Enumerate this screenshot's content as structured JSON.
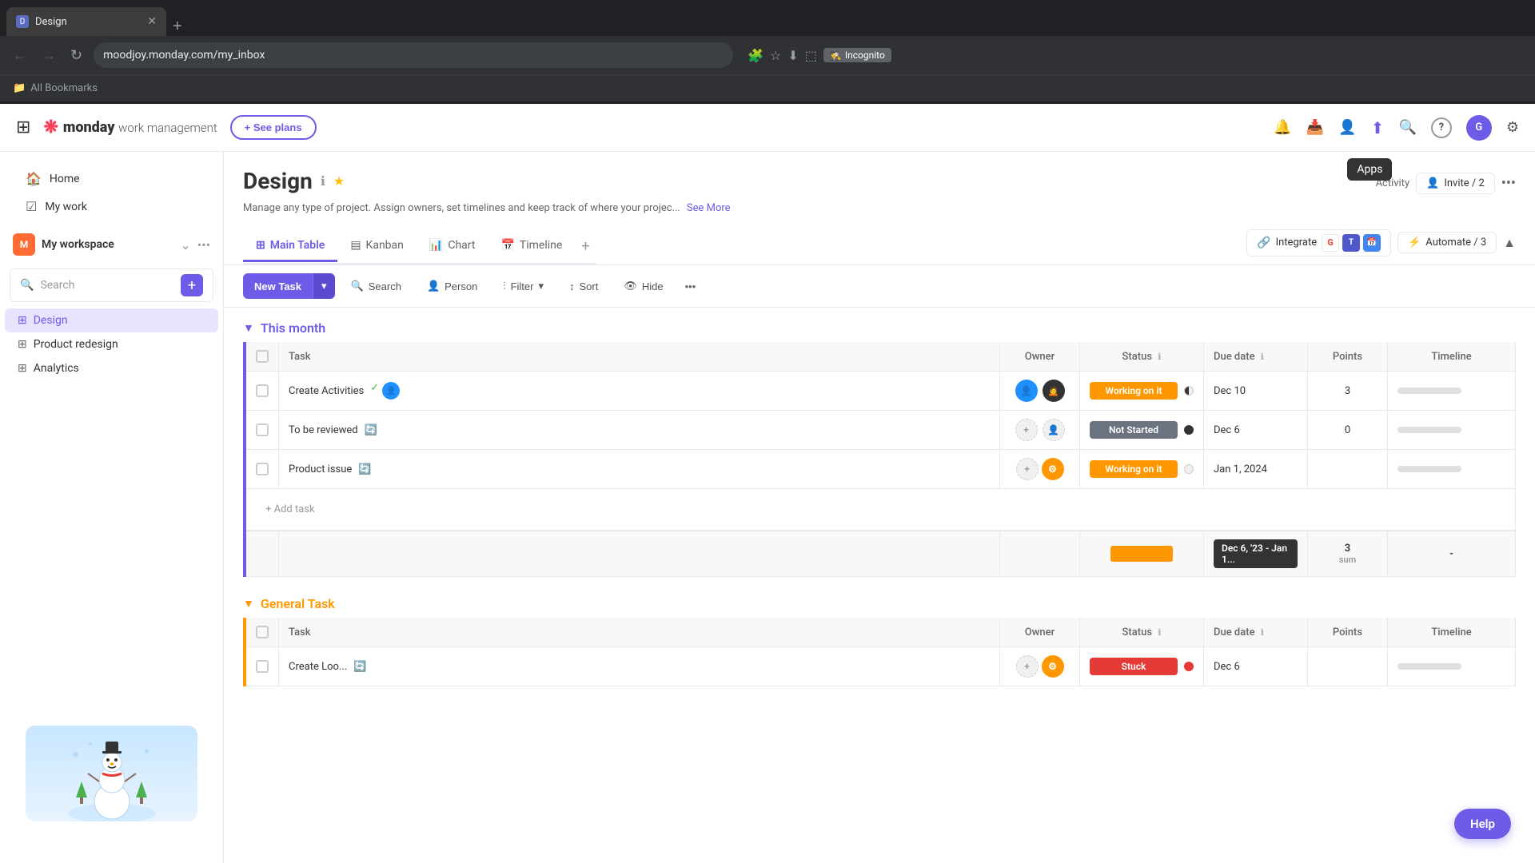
{
  "browser": {
    "tab_title": "Design",
    "tab_favicon": "D",
    "url": "moodjoy.monday.com/my_inbox",
    "tab_new_label": "+",
    "incognito_label": "Incognito",
    "bookmarks_label": "All Bookmarks"
  },
  "nav": {
    "grid_icon": "⊞",
    "logo_brand": "monday",
    "logo_suffix": "work management",
    "see_plans_label": "+ See plans",
    "bell_icon": "🔔",
    "inbox_icon": "📥",
    "person_icon": "👤",
    "update_icon": "⬆",
    "search_icon": "🔍",
    "help_icon": "?",
    "apps_tooltip": "Apps"
  },
  "sidebar": {
    "home_label": "Home",
    "mywork_label": "My work",
    "workspace_avatar": "M",
    "workspace_name": "My workspace",
    "search_placeholder": "Search",
    "add_icon": "+",
    "items": [
      {
        "label": "Design",
        "active": true
      },
      {
        "label": "Product redesign",
        "active": false
      },
      {
        "label": "Analytics",
        "active": false
      }
    ]
  },
  "page": {
    "title": "Design",
    "info_icon": "ℹ",
    "star_icon": "★",
    "description": "Manage any type of project. Assign owners, set timelines and keep track of where your projec...",
    "see_more": "See More",
    "activity_label": "Activity",
    "invite_label": "Invite / 2",
    "more_icon": "•••",
    "integrate_label": "Integrate",
    "automate_label": "Automate / 3",
    "collapse_icon": "▲"
  },
  "tabs": [
    {
      "label": "Main Table",
      "icon": "⊞",
      "active": true
    },
    {
      "label": "Kanban",
      "icon": "▤",
      "active": false
    },
    {
      "label": "Chart",
      "icon": "📊",
      "active": false
    },
    {
      "label": "Timeline",
      "icon": "📅",
      "active": false
    }
  ],
  "toolbar": {
    "new_task_label": "New Task",
    "search_label": "Search",
    "person_label": "Person",
    "filter_label": "Filter",
    "sort_label": "Sort",
    "hide_label": "Hide",
    "more_icon": "•••"
  },
  "groups": [
    {
      "title": "This month",
      "color": "#6c5ce7",
      "columns": [
        "Task",
        "Owner",
        "Status",
        "Due date",
        "Points",
        "Timeline"
      ],
      "rows": [
        {
          "task": "Create Activities",
          "owner": "avatar-blue",
          "owner2": "avatar-dark",
          "status": "Working on it",
          "status_class": "status-working",
          "due_date": "Dec 10",
          "status_dot_class": "dot-half",
          "points": "3",
          "timeline": ""
        },
        {
          "task": "To be reviewed",
          "owner": "avatar-empty",
          "owner2": "avatar-empty",
          "status": "Not Started",
          "status_class": "status-not-started",
          "due_date": "Dec 6",
          "status_dot_class": "dot-dark",
          "points": "0",
          "timeline": ""
        },
        {
          "task": "Product issue",
          "owner": "avatar-empty",
          "owner2": "avatar-gear",
          "status": "Working on it",
          "status_class": "status-working",
          "due_date": "Jan 1, 2024",
          "status_dot_class": "dot-empty",
          "points": "",
          "timeline": ""
        }
      ],
      "summary_date": "Dec 6, '23 - Jan 1...",
      "summary_points": "3",
      "summary_points_label": "sum",
      "add_task_label": "+ Add task"
    },
    {
      "title": "General Task",
      "color": "#ff9800",
      "columns": [
        "Task",
        "Owner",
        "Status",
        "Due date",
        "Points",
        "Timeline"
      ],
      "rows": [
        {
          "task": "Create Loo...",
          "owner": "avatar-empty",
          "owner2": "avatar-gear",
          "status": "Stuck",
          "status_class": "status-stuck",
          "due_date": "Dec 6",
          "status_dot_class": "dot-dark",
          "points": "",
          "timeline": ""
        }
      ]
    }
  ],
  "help_btn_label": "Help"
}
